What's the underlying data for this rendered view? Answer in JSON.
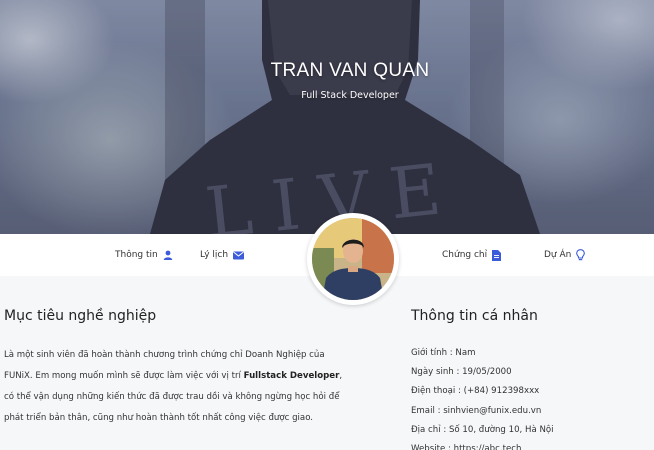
{
  "hero": {
    "name": "TRAN VAN QUAN",
    "role": "Full Stack Developer"
  },
  "nav": {
    "items": [
      {
        "label": "Thông tin",
        "icon": "user-icon"
      },
      {
        "label": "Lý lịch",
        "icon": "envelope-icon"
      },
      {
        "label": "Chứng chỉ",
        "icon": "document-icon"
      },
      {
        "label": "Dự Án",
        "icon": "lightbulb-icon"
      }
    ]
  },
  "objective": {
    "title": "Mục tiêu nghề nghiệp",
    "text_part1": "Là một sinh viên đã hoàn thành chương trình chứng chỉ Doanh Nghiệp của FUNiX. Em mong muốn mình sẽ được làm việc với vị trí ",
    "highlight": "Fullstack Developer",
    "text_part2": ", có thể vận dụng những kiến thức đã được trau dồi và không ngừng học hỏi để phát triển bản thân, cũng như hoàn thành tốt nhất công việc được giao."
  },
  "personal": {
    "title": "Thông tin cá nhân",
    "items": [
      "Giới tính : Nam",
      "Ngày sinh : 19/05/2000",
      "Điện thoại : (+84) 912398xxx",
      "Email : sinhvien@funix.edu.vn",
      "Địa chỉ : Số 10, đường 10, Hà Nội",
      "Website : https://abc.tech"
    ]
  },
  "colors": {
    "accent": "#3b5bdb",
    "page_bg": "#f5f7f9"
  }
}
